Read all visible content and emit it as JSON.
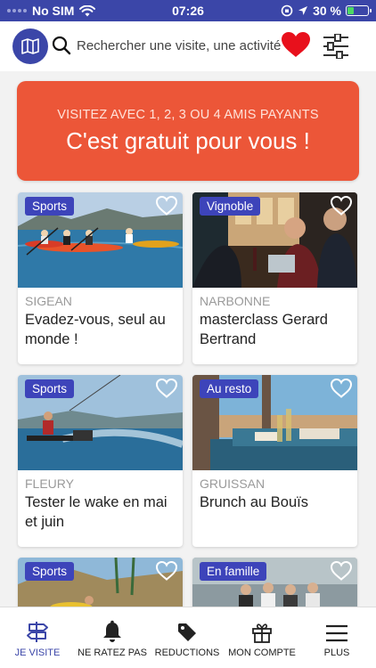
{
  "status_bar": {
    "carrier": "No SIM",
    "time": "07:26",
    "battery": "30 %",
    "battery_level": 0.3
  },
  "search": {
    "placeholder": "Rechercher une visite, une activité"
  },
  "promo": {
    "line1": "VISITEZ AVEC 1, 2, 3 OU 4 AMIS PAYANTS",
    "line2": "C'est gratuit pour vous !"
  },
  "cards": [
    {
      "category": "Sports",
      "city": "SIGEAN",
      "title": "Evadez-vous, seul au monde !"
    },
    {
      "category": "Vignoble",
      "city": "NARBONNE",
      "title": "masterclass Gerard Bertrand"
    },
    {
      "category": "Sports",
      "city": "FLEURY",
      "title": "Tester le wake en mai et juin"
    },
    {
      "category": "Au resto",
      "city": "GRUISSAN",
      "title": "Brunch au Bouïs"
    },
    {
      "category": "Sports",
      "city": "",
      "title": ""
    },
    {
      "category": "En famille",
      "city": "",
      "title": ""
    }
  ],
  "tabbar": {
    "items": [
      {
        "label": "JE VISITE",
        "icon": "signpost-icon",
        "active": true
      },
      {
        "label": "NE RATEZ PAS",
        "icon": "bell-icon",
        "active": false
      },
      {
        "label": "REDUCTIONS",
        "icon": "tag-icon",
        "active": false
      },
      {
        "label": "MON COMPTE",
        "icon": "gift-icon",
        "active": false
      },
      {
        "label": "PLUS",
        "icon": "menu-icon",
        "active": false
      }
    ]
  },
  "colors": {
    "brand": "#3b46a8",
    "promo": "#ec5638",
    "favorite": "#e8101c",
    "badge": "#3d44ba"
  }
}
